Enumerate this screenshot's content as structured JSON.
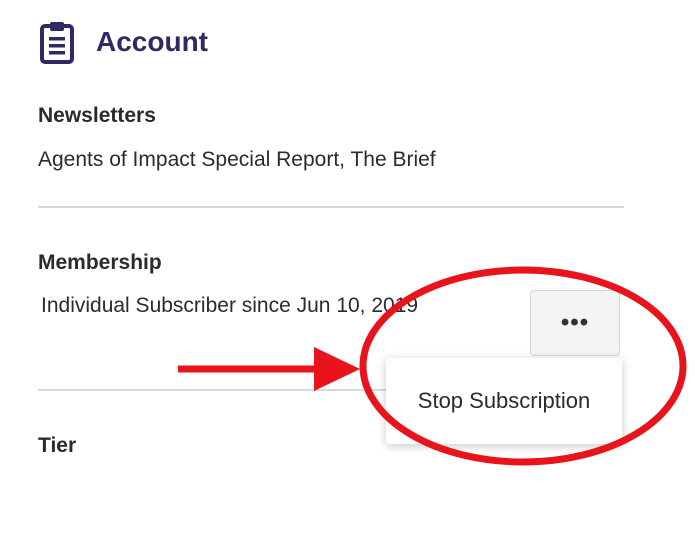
{
  "header": {
    "title": "Account",
    "icon": "clipboard-icon"
  },
  "newsletters": {
    "label": "Newsletters",
    "value": "Agents of Impact Special Report, The Brief"
  },
  "membership": {
    "label": "Membership",
    "value": "Individual Subscriber since Jun 10, 2019",
    "more_button_label": "•••",
    "menu": {
      "items": [
        "Stop Subscription"
      ]
    }
  },
  "tier": {
    "label": "Tier"
  },
  "colors": {
    "title": "#2d2a64",
    "annotation": "#e8131b"
  }
}
